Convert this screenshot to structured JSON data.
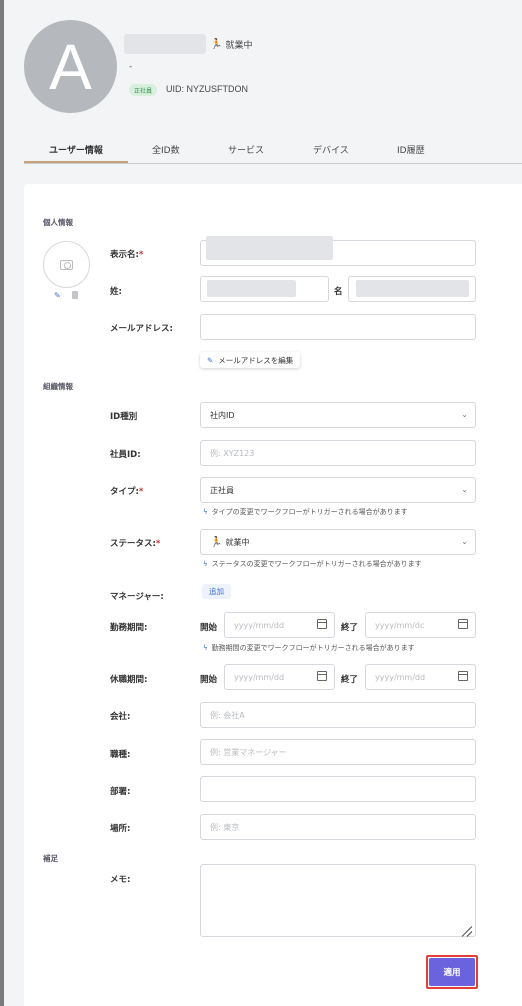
{
  "header": {
    "avatar_letter": "A",
    "status": "就業中",
    "secondary": "-",
    "badge": "正社員",
    "uid": "UID: NYZUSFTDON"
  },
  "tabs": [
    {
      "label": "ユーザー情報"
    },
    {
      "label": "全ID数"
    },
    {
      "label": "サービス"
    },
    {
      "label": "デバイス"
    },
    {
      "label": "ID履歴"
    }
  ],
  "sections": {
    "personal": "個人情報",
    "organization": "組織情報",
    "notes": "補足"
  },
  "personal": {
    "display_name_label": "表示名:",
    "last_name_label": "姓:",
    "first_name_label": "名",
    "email_label": "メールアドレス:",
    "edit_email_button": "メールアドレスを編集"
  },
  "org": {
    "id_type_label": "ID種別",
    "id_type_value": "社内ID",
    "employee_id_label": "社員ID:",
    "employee_id_placeholder": "例: XYZ123",
    "type_label": "タイプ:",
    "type_value": "正社員",
    "type_hint": "タイプの変更でワークフローがトリガーされる場合があります",
    "status_label": "ステータス:",
    "status_value": "就業中",
    "status_hint": "ステータスの変更でワークフローがトリガーされる場合があります",
    "manager_label": "マネージャー:",
    "manager_add": "追加",
    "employment_period_label": "勤務期間:",
    "start_label": "開始",
    "end_label": "終了",
    "date_placeholder_start": "yyyy/mm/dd",
    "date_placeholder_end": "yyyy/mm/dc",
    "employment_hint": "勤務期間の変更でワークフローがトリガーされる場合があります",
    "leave_period_label": "休職期間:",
    "company_label": "会社:",
    "company_placeholder": "例: 会社A",
    "job_label": "職種:",
    "job_placeholder": "例: 営業マネージャー",
    "department_label": "部署:",
    "location_label": "場所:",
    "location_placeholder": "例: 東京"
  },
  "notes": {
    "memo_label": "メモ:"
  },
  "actions": {
    "apply": "適用"
  },
  "colors": {
    "accent": "#6b63de",
    "link": "#3f6fd8",
    "tab_underline": "#c8a27a",
    "highlight_outline": "#e0403b"
  }
}
